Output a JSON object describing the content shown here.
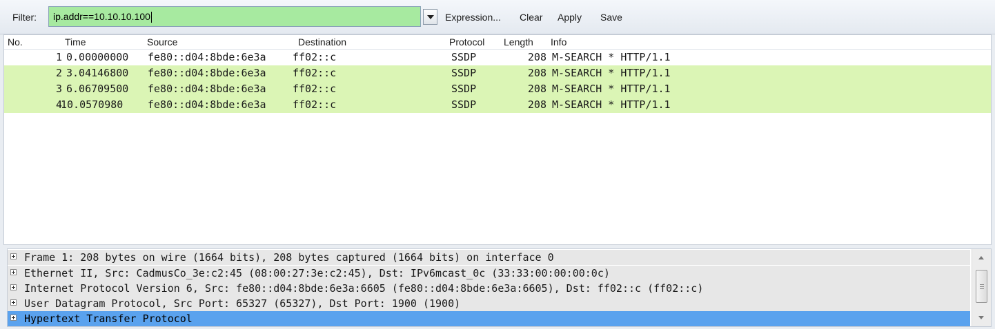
{
  "toolbar": {
    "filter_label": "Filter:",
    "filter_value": "ip.addr==10.10.10.100",
    "filter_valid_color": "#a7eaa0",
    "expression_label": "Expression...",
    "clear_label": "Clear",
    "apply_label": "Apply",
    "save_label": "Save"
  },
  "packet_list": {
    "columns": [
      "No.",
      "Time",
      "Source",
      "Destination",
      "Protocol",
      "Length",
      "Info"
    ],
    "rows": [
      {
        "no": "1",
        "time": "0.00000000",
        "source": "fe80::d04:8bde:6e3a",
        "destination": "ff02::c",
        "protocol": "SSDP",
        "length": "208",
        "info": "M-SEARCH * HTTP/1.1",
        "selected": false
      },
      {
        "no": "2",
        "time": "3.04146800",
        "source": "fe80::d04:8bde:6e3a",
        "destination": "ff02::c",
        "protocol": "SSDP",
        "length": "208",
        "info": "M-SEARCH * HTTP/1.1",
        "selected": false
      },
      {
        "no": "3",
        "time": "6.06709500",
        "source": "fe80::d04:8bde:6e3a",
        "destination": "ff02::c",
        "protocol": "SSDP",
        "length": "208",
        "info": "M-SEARCH * HTTP/1.1",
        "selected": false
      },
      {
        "no": "4",
        "time": "10.0570980",
        "source": "fe80::d04:8bde:6e3a",
        "destination": "ff02::c",
        "protocol": "SSDP",
        "length": "208",
        "info": "M-SEARCH * HTTP/1.1",
        "selected": false
      }
    ],
    "row_color": "#dbf5b5"
  },
  "details": {
    "items": [
      "Frame 1: 208 bytes on wire (1664 bits), 208 bytes captured (1664 bits) on interface 0",
      "Ethernet II, Src: CadmusCo_3e:c2:45 (08:00:27:3e:c2:45), Dst: IPv6mcast_0c (33:33:00:00:00:0c)",
      "Internet Protocol Version 6, Src: fe80::d04:8bde:6e3a:6605 (fe80::d04:8bde:6e3a:6605), Dst: ff02::c (ff02::c)",
      "User Datagram Protocol, Src Port: 65327 (65327), Dst Port: 1900 (1900)",
      "Hypertext Transfer Protocol"
    ],
    "selected_index": 4,
    "selected_color": "#5aa2ee"
  }
}
